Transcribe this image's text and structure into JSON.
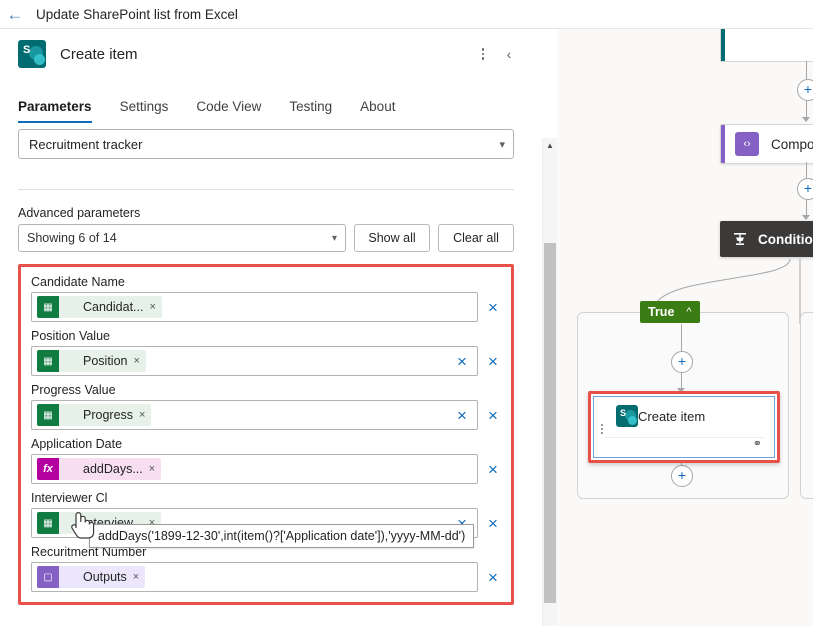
{
  "topbar": {
    "back_icon": "arrow-left-icon",
    "flow_title": "Update SharePoint list from Excel"
  },
  "panel": {
    "action_icon": "sharepoint-icon",
    "action_icon_letter": "S",
    "action_title": "Create item",
    "more_icon": "kebab-menu-icon",
    "collapse_icon": "chevron-left-icon",
    "tabs": [
      {
        "label": "Parameters",
        "active": true
      },
      {
        "label": "Settings",
        "active": false
      },
      {
        "label": "Code View",
        "active": false
      },
      {
        "label": "Testing",
        "active": false
      },
      {
        "label": "About",
        "active": false
      }
    ],
    "list_select": {
      "value": "Recruitment tracker",
      "chevron": "chevron-down-icon"
    },
    "advanced": {
      "label": "Advanced parameters",
      "select_value": "Showing 6 of 14",
      "chevron": "chevron-down-icon",
      "show_all_label": "Show all",
      "clear_all_label": "Clear all"
    },
    "fields": [
      {
        "label": "Candidate Name",
        "chip_text": "Candidat...",
        "chip_type": "excel",
        "chip_icon": "excel-icon",
        "chip_remove": "×",
        "has_clear": false,
        "row_remove": "×"
      },
      {
        "label": "Position Value",
        "chip_text": "Position",
        "chip_type": "excel",
        "chip_icon": "excel-icon",
        "chip_remove": "×",
        "has_clear": true,
        "clear_icon": "×",
        "row_remove": "×"
      },
      {
        "label": "Progress Value",
        "chip_text": "Progress",
        "chip_type": "excel",
        "chip_icon": "excel-icon",
        "chip_remove": "×",
        "has_clear": true,
        "clear_icon": "×",
        "row_remove": "×"
      },
      {
        "label": "Application Date",
        "chip_text": "addDays...",
        "chip_type": "fx",
        "chip_icon": "function-fx-icon",
        "chip_icon_text": "fx",
        "chip_remove": "×",
        "has_clear": false,
        "row_remove": "×"
      },
      {
        "label": "Interviewer Cl",
        "chip_text": "Interview...",
        "chip_type": "excel",
        "chip_icon": "excel-icon",
        "chip_remove": "×",
        "has_clear": true,
        "clear_icon": "×",
        "row_remove": "×"
      },
      {
        "label": "Recuritment Number",
        "chip_text": "Outputs",
        "chip_type": "compose",
        "chip_icon": "compose-icon",
        "chip_remove": "×",
        "has_clear": false,
        "row_remove": "×"
      }
    ],
    "tooltip_text": "addDays('1899-12-30',int(item()?['Application date']),'yyyy-MM-dd')",
    "scrollbar": {
      "up_arrow": "▲"
    }
  },
  "canvas": {
    "compose_node": {
      "label": "Compos",
      "icon": "compose-icon",
      "icon_glyph": "‹›"
    },
    "condition_node": {
      "label": "Condition",
      "icon": "condition-icon"
    },
    "true_branch": {
      "label": "True",
      "chevron": "˄"
    },
    "selected_node": {
      "label": "Create item",
      "icon": "sharepoint-icon",
      "icon_letter": "S",
      "link_icon": "link-icon"
    },
    "add_icon": "+"
  }
}
